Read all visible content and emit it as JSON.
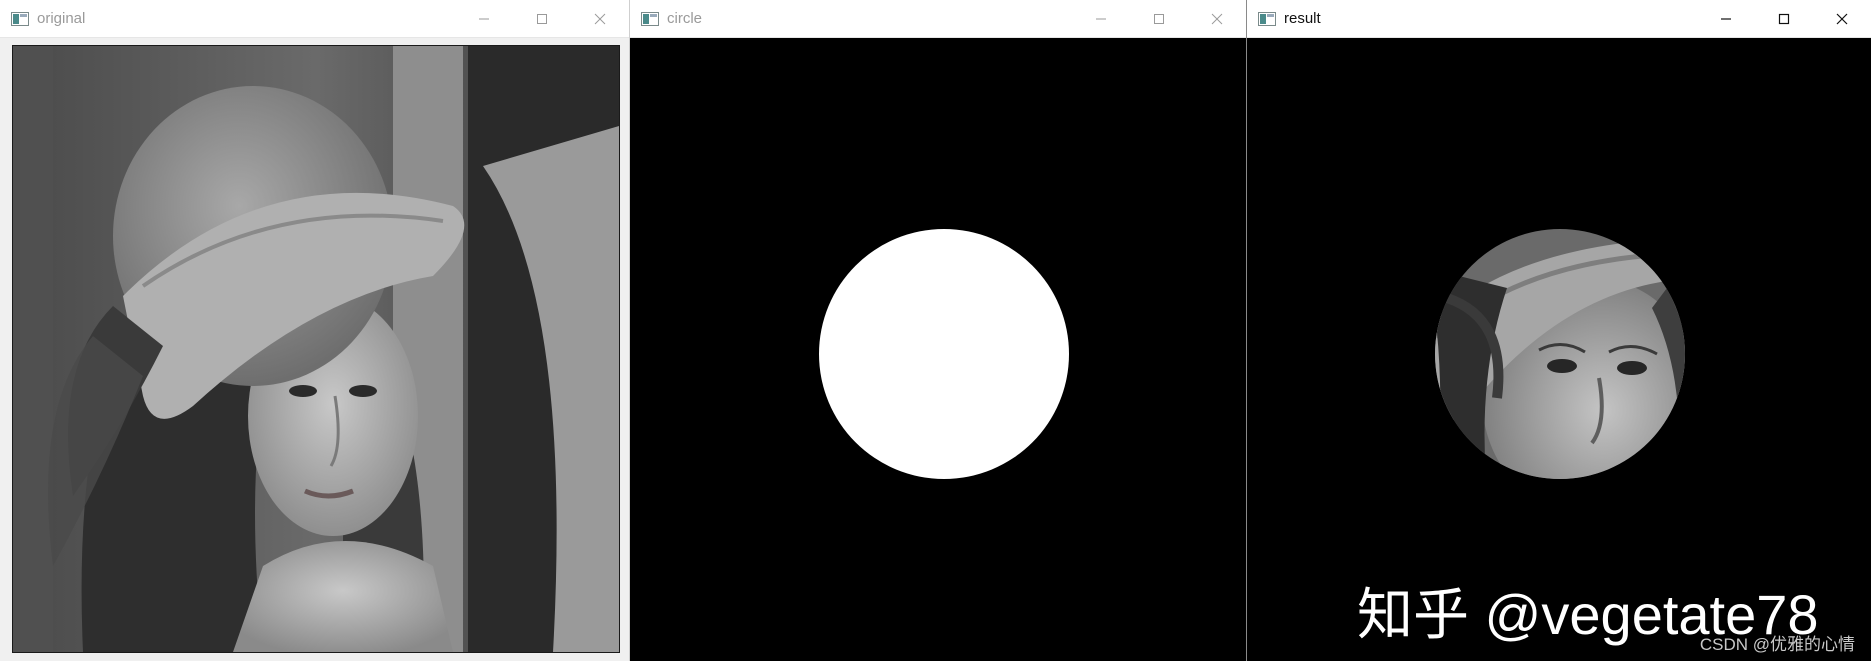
{
  "windows": {
    "original": {
      "title": "original",
      "icon": "opencv-window-icon",
      "controls": [
        "minimize-icon",
        "maximize-icon",
        "close-icon"
      ]
    },
    "circle": {
      "title": "circle",
      "icon": "opencv-window-icon",
      "controls": [
        "minimize-icon",
        "maximize-icon",
        "close-icon"
      ]
    },
    "result": {
      "title": "result",
      "icon": "opencv-window-icon",
      "controls": [
        "minimize-icon",
        "maximize-icon",
        "close-icon"
      ]
    }
  },
  "overlay": {
    "watermark": "知乎 @vegetate78",
    "credit": "CSDN @优雅的心情"
  },
  "colors": {
    "mask_background": "#000000",
    "mask_circle": "#ffffff",
    "titlebar": "#ffffff",
    "inactive_title": "#9a9a9a",
    "active_title": "#111111"
  }
}
